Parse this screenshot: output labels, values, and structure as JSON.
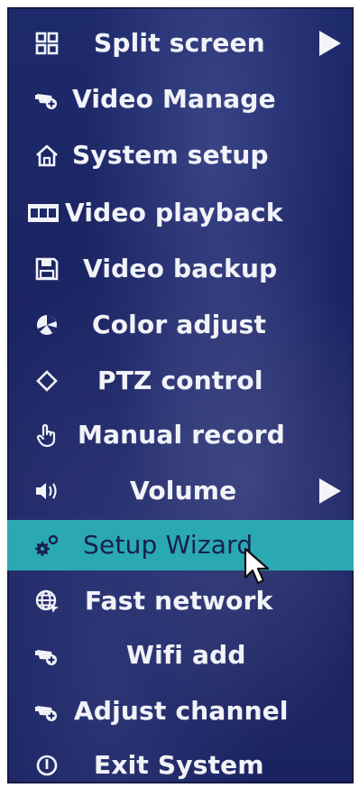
{
  "menu": {
    "items": [
      {
        "label": "Split screen",
        "icon": "split-screen-grid-icon",
        "submenu": true
      },
      {
        "label": "Video Manage",
        "icon": "camera-plus-icon"
      },
      {
        "label": "System setup",
        "icon": "home-icon"
      },
      {
        "label": "Video playback",
        "icon": "film-strip-icon"
      },
      {
        "label": "Video backup",
        "icon": "floppy-disk-icon"
      },
      {
        "label": "Color adjust",
        "icon": "color-palette-icon"
      },
      {
        "label": "PTZ control",
        "icon": "diamond-icon"
      },
      {
        "label": "Manual record",
        "icon": "hand-pointer-icon"
      },
      {
        "label": "Volume",
        "icon": "speaker-icon",
        "submenu": true
      },
      {
        "label": "Setup Wizard",
        "icon": "gears-icon",
        "selected": true
      },
      {
        "label": "Fast network",
        "icon": "globe-network-icon"
      },
      {
        "label": "Wifi add",
        "icon": "camera-plus-icon"
      },
      {
        "label": "Adjust channel",
        "icon": "camera-plus-icon"
      },
      {
        "label": "Exit System",
        "icon": "power-icon"
      }
    ]
  },
  "colors": {
    "menu_background": "#1d2a6b",
    "selected_background": "#2aa9b3",
    "text": "#f2f3f8"
  }
}
